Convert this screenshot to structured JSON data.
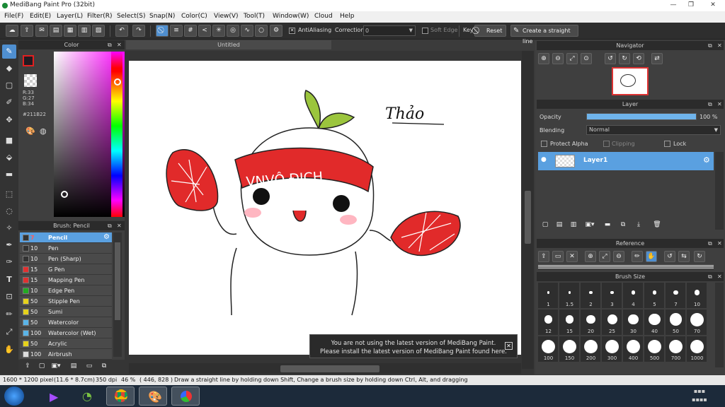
{
  "window": {
    "title": "MediBang Paint Pro (32bit)",
    "controls": [
      "—",
      "❐",
      "✕"
    ]
  },
  "menu": [
    "File(F)",
    "Edit(E)",
    "Layer(L)",
    "Filter(R)",
    "Select(S)",
    "Snap(N)",
    "Color(C)",
    "View(V)",
    "Tool(T)",
    "Window(W)",
    "Cloud",
    "Help"
  ],
  "toolbar": {
    "antialiasing_label": "AntiAliasing",
    "antialiasing_checked": true,
    "correction_label": "Correction",
    "correction_value": "0",
    "soft_edge_label": "Soft Edge",
    "soft_edge_checked": false,
    "key_label": "Key",
    "reset_label": "Reset",
    "straight_line_label": "Create a straight line"
  },
  "color_panel": {
    "title": "Color",
    "r_label": "R:33",
    "g_label": "G:27",
    "b_label": "B:34",
    "hex": "#211B22",
    "foreground": "#211b22",
    "background_swatch": "#ffffff"
  },
  "brush_panel": {
    "title": "Brush: Pencil",
    "items": [
      {
        "size": "7",
        "name": "Pencil",
        "color": "#333333",
        "selected": true
      },
      {
        "size": "10",
        "name": "Pen",
        "color": "#333333",
        "selected": false
      },
      {
        "size": "10",
        "name": "Pen (Sharp)",
        "color": "#333333",
        "selected": false
      },
      {
        "size": "15",
        "name": "G Pen",
        "color": "#e03030",
        "selected": false
      },
      {
        "size": "15",
        "name": "Mapping Pen",
        "color": "#e03030",
        "selected": false
      },
      {
        "size": "10",
        "name": "Edge Pen",
        "color": "#22aa22",
        "selected": false
      },
      {
        "size": "50",
        "name": "Stipple Pen",
        "color": "#e6d21c",
        "selected": false
      },
      {
        "size": "50",
        "name": "Sumi",
        "color": "#e6d21c",
        "selected": false
      },
      {
        "size": "50",
        "name": "Watercolor",
        "color": "#5ab4e8",
        "selected": false
      },
      {
        "size": "100",
        "name": "Watercolor (Wet)",
        "color": "#5ab4e8",
        "selected": false
      },
      {
        "size": "50",
        "name": "Acrylic",
        "color": "#e6d21c",
        "selected": false
      },
      {
        "size": "100",
        "name": "Airbrush",
        "color": "#dddddd",
        "selected": false
      }
    ]
  },
  "document": {
    "tab_title": "Untitled",
    "banner_text": "VNVÔ ĐỊCH",
    "signature_text": "Thảo"
  },
  "notice": {
    "line1": "You are not using the latest version of MediBang Paint.",
    "line2": "Please install the latest version of MediBang Paint found here."
  },
  "navigator": {
    "title": "Navigator"
  },
  "layer_panel": {
    "title": "Layer",
    "opacity_label": "Opacity",
    "opacity_value": "100 %",
    "opacity_fraction": 1.0,
    "blending_label": "Blending",
    "blending_value": "Normal",
    "protect_alpha_label": "Protect Alpha",
    "clipping_label": "Clipping",
    "lock_label": "Lock",
    "layer_name": "Layer1"
  },
  "reference": {
    "title": "Reference"
  },
  "brush_size": {
    "title": "Brush Size",
    "sizes": [
      "1",
      "1.5",
      "2",
      "3",
      "4",
      "5",
      "7",
      "10",
      "12",
      "15",
      "20",
      "25",
      "30",
      "40",
      "50",
      "70",
      "100",
      "150",
      "200",
      "300",
      "400",
      "500",
      "700",
      "1000"
    ]
  },
  "status": {
    "dimensions": "1600 * 1200 pixel",
    "physical": "(11.6 * 8.7cm)",
    "dpi": "350 dpi",
    "zoom": "46 %",
    "coords": "( 446, 828 )",
    "hint": "Draw a straight line by holding down Shift, Change a brush size by holding down Ctrl, Alt, and dragging"
  }
}
